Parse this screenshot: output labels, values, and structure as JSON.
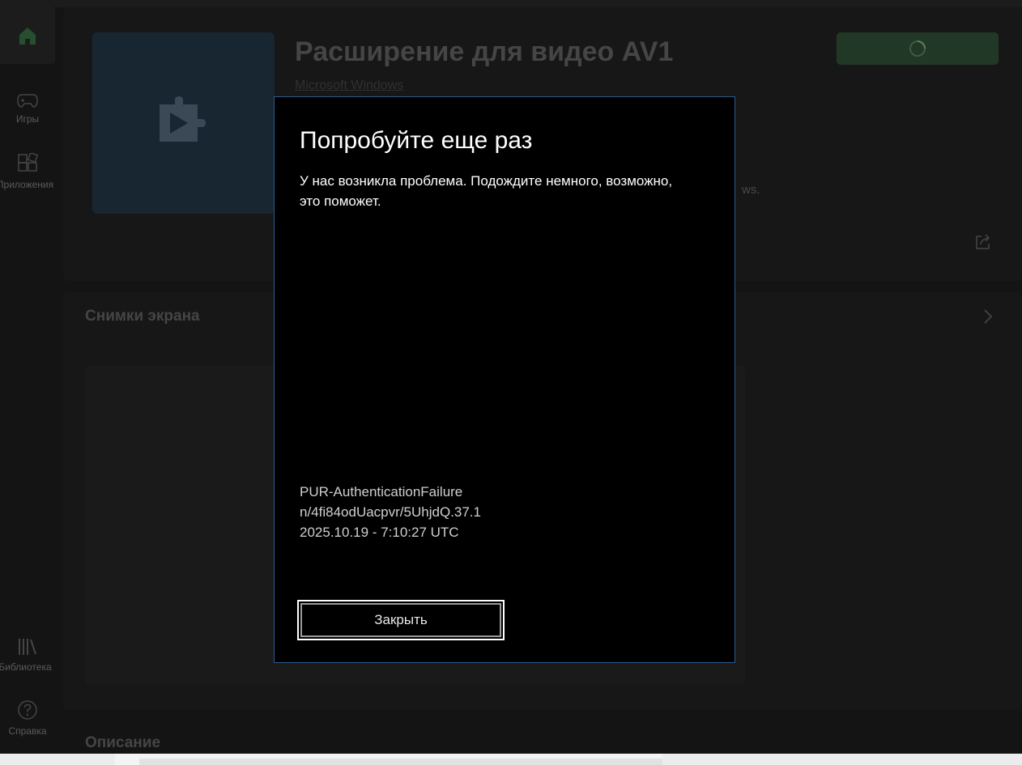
{
  "sidebar": {
    "items": [
      {
        "icon": "home-icon",
        "label": ""
      },
      {
        "icon": "gamepad-icon",
        "label": "Игры"
      },
      {
        "icon": "apps-icon",
        "label": "Приложения"
      },
      {
        "icon": "library-icon",
        "label": "Библиотека"
      },
      {
        "icon": "help-icon",
        "label": "Справка"
      }
    ]
  },
  "app": {
    "title": "Расширение для видео AV1",
    "publisher": "Microsoft Windows",
    "description_visible_tail": "ws."
  },
  "sections": {
    "screenshots_title": "Снимки экрана",
    "description_title": "Описание"
  },
  "dialog": {
    "title": "Попробуйте еще раз",
    "message": "У нас возникла проблема. Подождите немного, возможно, это поможет.",
    "error_code": "PUR-AuthenticationFailure",
    "correlation_id": "n/4fi84odUacpvr/5UhjdQ.37.1",
    "timestamp": "2025.10.19 - 7:10:27 UTC",
    "close_label": "Закрыть"
  },
  "colors": {
    "accent_green": "#35573c",
    "dialog_border": "#2c5b8c",
    "tile_blue": "#263b4d"
  }
}
